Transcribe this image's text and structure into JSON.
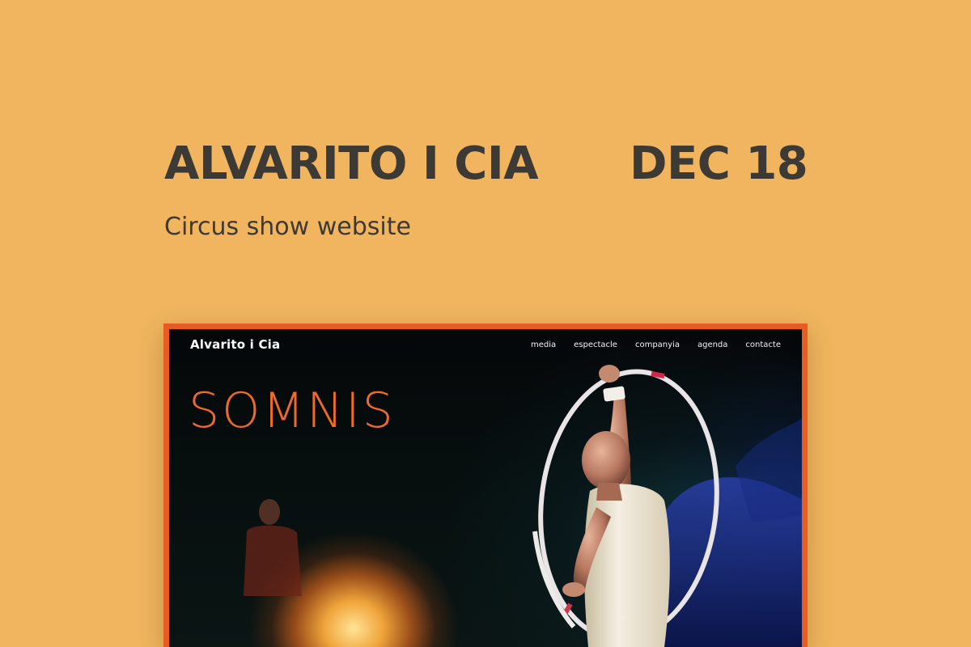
{
  "header": {
    "title": "ALVARITO I CIA",
    "date": "DEC 18",
    "subtitle": "Circus show website"
  },
  "site": {
    "logo": "Alvarito i Cia",
    "nav": [
      {
        "label": "media"
      },
      {
        "label": "espectacle"
      },
      {
        "label": "companyia"
      },
      {
        "label": "agenda"
      },
      {
        "label": "contacte"
      }
    ],
    "hero_title": "SOMNIS"
  },
  "colors": {
    "background": "#f0b55e",
    "text": "#3d3935",
    "accent": "#e85b22",
    "hero_title": "#ee6a2a"
  }
}
